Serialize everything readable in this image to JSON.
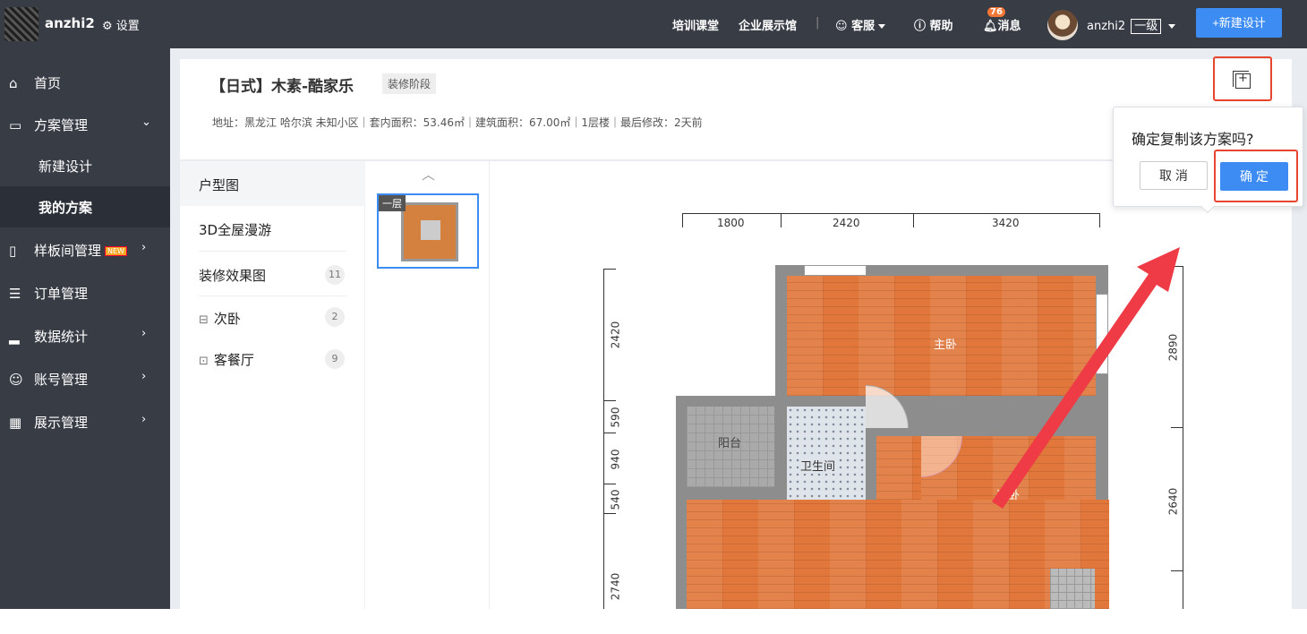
{
  "topbar": {
    "brand": "anzhi2",
    "settings": "设置",
    "nav": [
      "培训课堂",
      "企业展示馆"
    ],
    "service": "客服",
    "help": "帮助",
    "message_count": "76",
    "messages": "消息",
    "user": "anzhi2",
    "level": "一级",
    "new_design": "+新建设计"
  },
  "sidebar": {
    "home": "首页",
    "plan_mgmt": "方案管理",
    "new_design": "新建设计",
    "my_plans": "我的方案",
    "sample_mgmt": "样板间管理",
    "new_badge": "NEW",
    "orders": "订单管理",
    "stats": "数据统计",
    "account": "账号管理",
    "display": "展示管理"
  },
  "header": {
    "title": "【日式】木素-酷家乐",
    "stage": "装修阶段",
    "meta": "地址：黑龙江 哈尔滨 未知小区｜套内面积：53.46㎡｜建筑面积：67.00㎡｜1层楼｜最后修改：2天前"
  },
  "left_nav": {
    "floor_plan": "户型图",
    "tour": "3D全屋漫游",
    "renders": "装修效果图",
    "renders_count": "11",
    "second_bedroom": "次卧",
    "second_bedroom_count": "2",
    "living_dining": "客餐厅",
    "living_dining_count": "9"
  },
  "thumbs": {
    "floor_tag": "一层"
  },
  "plan": {
    "dims_top": [
      "1800",
      "2420",
      "3420"
    ],
    "dims_left": [
      "2420",
      "590",
      "940",
      "540",
      "2740"
    ],
    "dims_right": [
      "2890",
      "2640"
    ],
    "rooms": {
      "master": "主卧",
      "balcony": "阳台",
      "bathroom": "卫生间",
      "second": "次卧"
    }
  },
  "popover": {
    "question": "确定复制该方案吗?",
    "cancel": "取 消",
    "confirm": "确 定"
  },
  "colors": {
    "accent": "#3c8cf4",
    "topbar": "#373c45",
    "highlight": "#e8452e",
    "arrow": "#ee3b45"
  }
}
